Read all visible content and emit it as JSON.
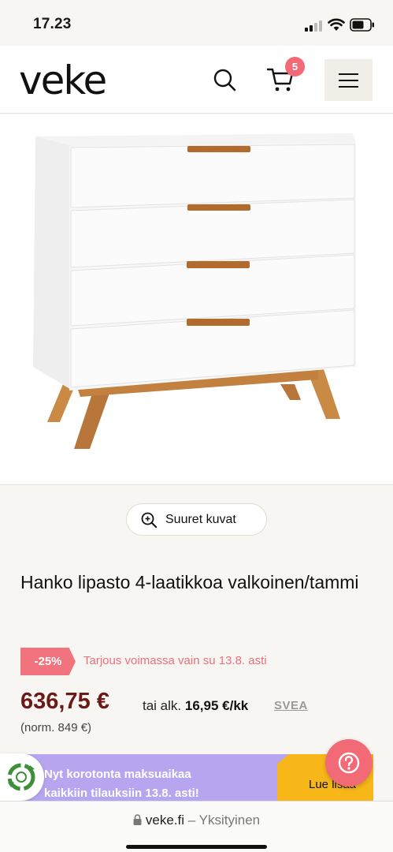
{
  "status_bar": {
    "time": "17.23"
  },
  "header": {
    "logo": "veke",
    "cart_count": "5"
  },
  "gallery": {
    "button_label": "Suuret kuvat"
  },
  "product": {
    "title": "Hanko lipasto 4-laatikkoa valkoinen/tammi",
    "discount": "-25%",
    "offer_text": "Tarjous voimassa vain su 13.8. asti",
    "price": "636,75 €",
    "installment_prefix": "tai alk.",
    "installment_amount": "16,95 €/kk",
    "financing_brand": "SVEA",
    "normal_price": "(norm. 849 €)"
  },
  "promo": {
    "line1": "Nyt korotonta maksuaikaa",
    "line2": "kaikkiin tilauksiin 13.8. asti!",
    "cta": "Lue lisää"
  },
  "browser": {
    "domain": "veke.fi",
    "separator": "–",
    "mode": "Yksityinen"
  },
  "colors": {
    "accent_pink": "#f26a75",
    "price_red": "#6a1a17",
    "promo_purple": "#b7a5f0",
    "promo_yellow": "#f7b718"
  }
}
